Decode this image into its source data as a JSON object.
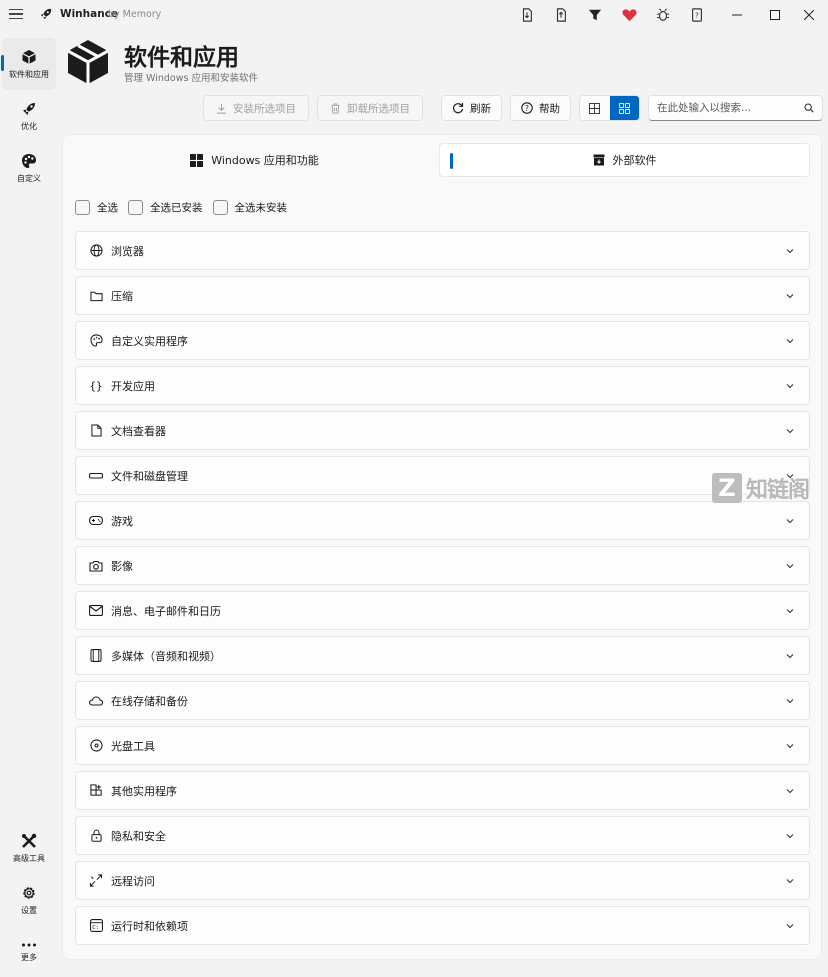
{
  "window": {
    "app_title": "Winhance",
    "app_subtitle": "by Memory"
  },
  "nav": {
    "items": [
      {
        "label": "软件和应用",
        "icon": "package-icon"
      },
      {
        "label": "优化",
        "icon": "rocket-icon"
      },
      {
        "label": "自定义",
        "icon": "palette-icon"
      }
    ],
    "bottom": [
      {
        "label": "高级工具",
        "icon": "tools-icon"
      },
      {
        "label": "设置",
        "icon": "gear-icon"
      },
      {
        "label": "更多",
        "icon": "more-icon"
      }
    ]
  },
  "header": {
    "title": "软件和应用",
    "subtitle": "管理 Windows 应用和安装软件"
  },
  "toolbar": {
    "install_label": "安装所选项目",
    "uninstall_label": "卸载所选项目",
    "refresh_label": "刷新",
    "help_label": "帮助",
    "search_placeholder": "在此处输入以搜索..."
  },
  "tabs": [
    {
      "label": "Windows 应用和功能"
    },
    {
      "label": "外部软件"
    }
  ],
  "checks": {
    "all": "全选",
    "all_installed": "全选已安装",
    "all_not_installed": "全选未安装"
  },
  "categories": [
    {
      "label": "浏览器",
      "icon": "globe-icon"
    },
    {
      "label": "压缩",
      "icon": "folder-icon"
    },
    {
      "label": "自定义实用程序",
      "icon": "palette-icon"
    },
    {
      "label": "开发应用",
      "icon": "braces-icon"
    },
    {
      "label": "文档查看器",
      "icon": "document-icon"
    },
    {
      "label": "文件和磁盘管理",
      "icon": "drive-icon"
    },
    {
      "label": "游戏",
      "icon": "gamepad-icon"
    },
    {
      "label": "影像",
      "icon": "camera-icon"
    },
    {
      "label": "消息、电子邮件和日历",
      "icon": "mail-icon"
    },
    {
      "label": "多媒体（音频和视频）",
      "icon": "film-icon"
    },
    {
      "label": "在线存储和备份",
      "icon": "cloud-icon"
    },
    {
      "label": "光盘工具",
      "icon": "disc-icon"
    },
    {
      "label": "其他实用程序",
      "icon": "apps-add-icon"
    },
    {
      "label": "隐私和安全",
      "icon": "lock-icon"
    },
    {
      "label": "远程访问",
      "icon": "remote-icon"
    },
    {
      "label": "运行时和依赖项",
      "icon": "runtime-icon"
    }
  ],
  "watermark": {
    "letter": "Z",
    "text": "知链阁"
  },
  "colors": {
    "accent": "#0067c0",
    "heart": "#e0303c"
  }
}
